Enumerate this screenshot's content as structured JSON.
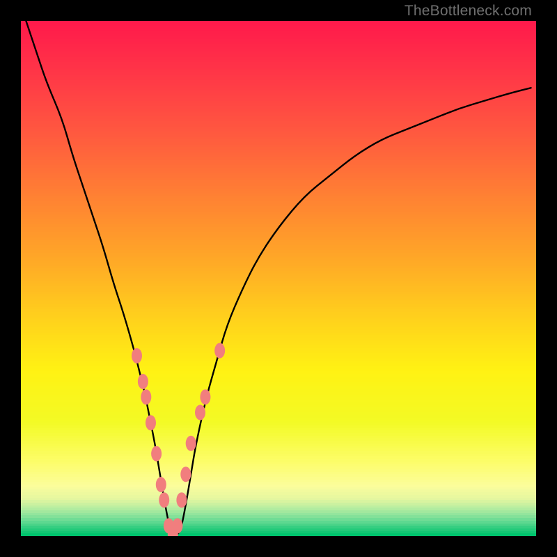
{
  "watermark": "TheBottleneck.com",
  "colors": {
    "curve": "#000000",
    "dot_fill": "#f17e7e",
    "dot_stroke": "#ae2c2c",
    "frame": "#000000"
  },
  "chart_data": {
    "type": "line",
    "title": "",
    "xlabel": "",
    "ylabel": "",
    "xlim": [
      0,
      100
    ],
    "ylim": [
      0,
      100
    ],
    "curve": {
      "x": [
        1,
        3,
        5,
        8,
        10,
        12,
        14,
        16,
        18,
        20,
        22,
        23,
        24,
        25,
        26,
        27,
        28,
        29,
        30,
        31,
        32,
        33,
        34,
        36,
        38,
        40,
        43,
        46,
        50,
        55,
        60,
        65,
        70,
        75,
        80,
        85,
        90,
        95,
        99
      ],
      "y": [
        100,
        94,
        88,
        81,
        74,
        68,
        62,
        56,
        49,
        43,
        36,
        32,
        28,
        23,
        18,
        12,
        6,
        1,
        0,
        1,
        6,
        12,
        18,
        27,
        34,
        41,
        48,
        54,
        60,
        66,
        70,
        74,
        77,
        79,
        81,
        83,
        84.5,
        86,
        87
      ]
    },
    "dots": [
      {
        "x": 22.5,
        "y": 35
      },
      {
        "x": 23.7,
        "y": 30
      },
      {
        "x": 24.3,
        "y": 27
      },
      {
        "x": 25.2,
        "y": 22
      },
      {
        "x": 26.3,
        "y": 16
      },
      {
        "x": 27.2,
        "y": 10
      },
      {
        "x": 27.8,
        "y": 7
      },
      {
        "x": 28.7,
        "y": 2
      },
      {
        "x": 29.5,
        "y": 0.3
      },
      {
        "x": 30.4,
        "y": 2
      },
      {
        "x": 31.2,
        "y": 7
      },
      {
        "x": 32.0,
        "y": 12
      },
      {
        "x": 33.0,
        "y": 18
      },
      {
        "x": 34.8,
        "y": 24
      },
      {
        "x": 35.8,
        "y": 27
      },
      {
        "x": 38.6,
        "y": 36
      }
    ],
    "gradient_stops": [
      {
        "pos": 0.0,
        "color": "#ff1a4b"
      },
      {
        "pos": 0.1,
        "color": "#ff3647"
      },
      {
        "pos": 0.22,
        "color": "#ff5a3f"
      },
      {
        "pos": 0.34,
        "color": "#ff8133"
      },
      {
        "pos": 0.46,
        "color": "#ffa727"
      },
      {
        "pos": 0.58,
        "color": "#ffd21c"
      },
      {
        "pos": 0.68,
        "color": "#fff213"
      },
      {
        "pos": 0.78,
        "color": "#f3fa25"
      },
      {
        "pos": 0.86,
        "color": "#fdfd6c"
      },
      {
        "pos": 0.905,
        "color": "#fbfd9c"
      },
      {
        "pos": 0.93,
        "color": "#e4f6a0"
      },
      {
        "pos": 0.948,
        "color": "#b6eda0"
      },
      {
        "pos": 0.962,
        "color": "#8de39c"
      },
      {
        "pos": 0.975,
        "color": "#5dd890"
      },
      {
        "pos": 0.988,
        "color": "#2acb7c"
      },
      {
        "pos": 1.0,
        "color": "#00c46e"
      }
    ]
  }
}
